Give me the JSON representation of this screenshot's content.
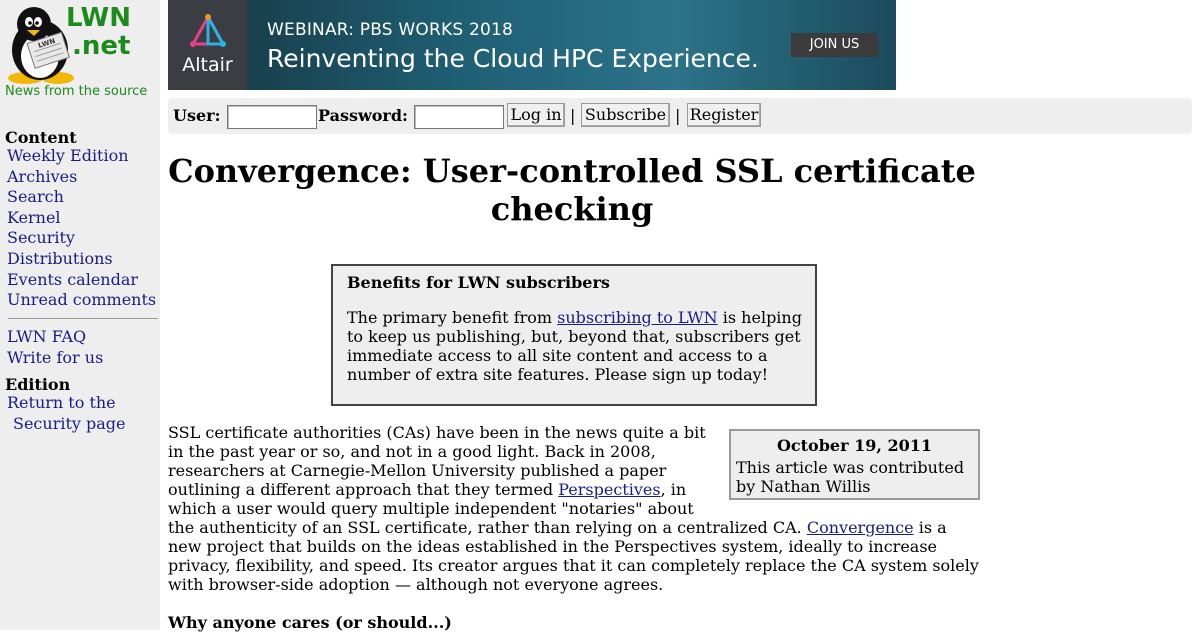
{
  "site": {
    "logo_text_line1": "LWN",
    "logo_text_line2": ".net",
    "tagline": "News from the source",
    "logo_badge": "LWN"
  },
  "sidebar": {
    "content_heading": "Content",
    "content_items": [
      "Weekly Edition",
      "Archives",
      "Search",
      "Kernel",
      "Security",
      "Distributions",
      "Events calendar",
      "Unread comments"
    ],
    "extra_items": [
      "LWN FAQ",
      "Write for us"
    ],
    "edition_heading": "Edition",
    "edition_link_line1": "Return to the",
    "edition_link_line2": "Security page"
  },
  "banner": {
    "logo_text": "Altair",
    "kicker": "WEBINAR: PBS WORKS 2018",
    "headline": "Reinventing the Cloud HPC Experience.",
    "cta": "JOIN US"
  },
  "login": {
    "user_label": "User:",
    "user_value": "",
    "password_label": "Password:",
    "password_value": "",
    "login_button": "Log in",
    "subscribe_button": "Subscribe",
    "register_button": "Register",
    "separator": "|"
  },
  "article": {
    "title": "Convergence: User-controlled SSL certificate checking",
    "subscriber_box": {
      "title": "Benefits for LWN subscribers",
      "text_before": "The primary benefit from ",
      "link_text": "subscribing to LWN",
      "text_after": " is helping to keep us publishing, but, beyond that, subscribers get immediate access to all site content and access to a number of extra site features. Please sign up today!"
    },
    "date_box": {
      "date": "October 19, 2011",
      "credit": "This article was contributed by Nathan Willis"
    },
    "paragraph1": {
      "part1": "SSL certificate authorities (CAs) have been in the news quite a bit in the past year or so, and not in a good light. Back in 2008, researchers at Carnegie-Mellon University published a paper outlining a different approach that they termed ",
      "link1": "Perspectives",
      "part2": ", in which a user would query multiple independent \"notaries\" about the authenticity of an SSL certificate, rather than relying on a centralized CA. ",
      "link2": "Convergence",
      "part3": " is a new project that builds on the ideas established in the Perspectives system, ideally to increase privacy, flexibility, and speed. Its creator argues that it can completely replace the CA system solely with browser-side adoption — although not everyone agrees."
    },
    "section_heading": "Why anyone cares (or should...)"
  },
  "colors": {
    "sidebar_bg": "#eeeeee",
    "logo_green": "#1d8a1d",
    "link": "#1a1a8c"
  }
}
